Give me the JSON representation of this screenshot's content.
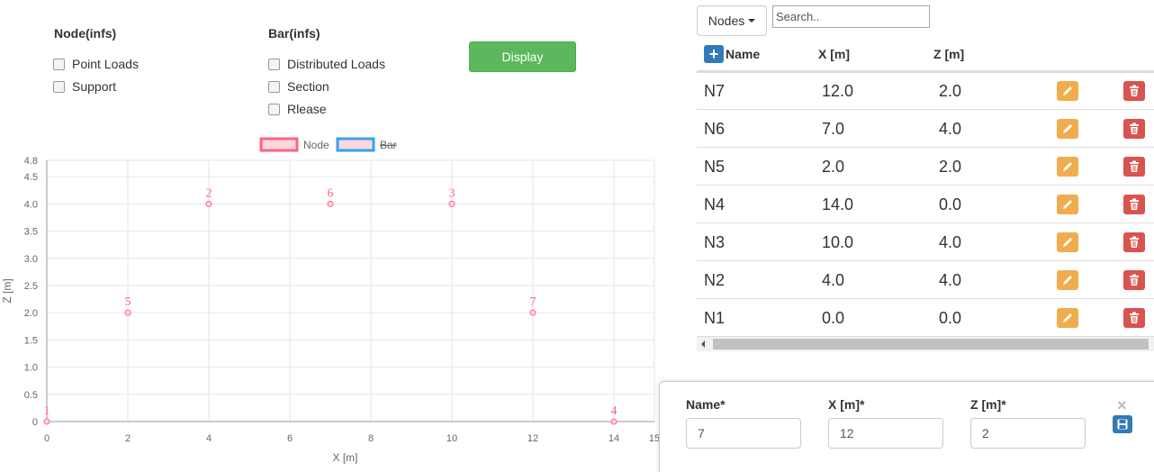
{
  "controls": {
    "node_group_title": "Node(infs)",
    "node_options": [
      "Point Loads",
      "Support"
    ],
    "bar_group_title": "Bar(infs)",
    "bar_options": [
      "Distributed Loads",
      "Section",
      "Rlease"
    ],
    "display_label": "Display"
  },
  "chart_data": {
    "type": "scatter",
    "legend": [
      {
        "label": "Node",
        "border": "#ff6384",
        "fill": "#ffd6de",
        "hidden": false
      },
      {
        "label": "Bar",
        "border": "#36a2eb",
        "fill": "#ffd6de",
        "hidden": true
      }
    ],
    "legend_position": "top-center",
    "xlabel": "X [m]",
    "ylabel": "Z [m]",
    "xlim": [
      0,
      15
    ],
    "ylim": [
      0,
      4.8
    ],
    "x_ticks": [
      "0",
      "2",
      "4",
      "6",
      "8",
      "10",
      "12",
      "14",
      "15"
    ],
    "y_ticks": [
      "0",
      "0.5",
      "1.0",
      "1.5",
      "2.0",
      "2.5",
      "3.0",
      "3.5",
      "4.0",
      "4.5",
      "4.8"
    ],
    "grid": true,
    "point_color": "#ff6384",
    "points": [
      {
        "label": "1",
        "x": 0,
        "y": 0
      },
      {
        "label": "2",
        "x": 4,
        "y": 4
      },
      {
        "label": "3",
        "x": 10,
        "y": 4
      },
      {
        "label": "4",
        "x": 14,
        "y": 0
      },
      {
        "label": "5",
        "x": 2,
        "y": 2
      },
      {
        "label": "6",
        "x": 7,
        "y": 4
      },
      {
        "label": "7",
        "x": 12,
        "y": 2
      }
    ]
  },
  "table": {
    "dropdown_label": "Nodes",
    "search_placeholder": "Search..",
    "add_icon": "plus-icon",
    "headers": [
      "Name",
      "X [m]",
      "Z [m]"
    ],
    "rows": [
      {
        "name": "N7",
        "x": "12.0",
        "z": "2.0"
      },
      {
        "name": "N6",
        "x": "7.0",
        "z": "4.0"
      },
      {
        "name": "N5",
        "x": "2.0",
        "z": "2.0"
      },
      {
        "name": "N4",
        "x": "14.0",
        "z": "0.0"
      },
      {
        "name": "N3",
        "x": "10.0",
        "z": "4.0"
      },
      {
        "name": "N2",
        "x": "4.0",
        "z": "4.0"
      },
      {
        "name": "N1",
        "x": "0.0",
        "z": "0.0"
      }
    ],
    "edit_color": "#f0ad4e",
    "delete_color": "#d9534f"
  },
  "edit_form": {
    "name_label": "Name*",
    "name_value": "7",
    "x_label": "X [m]*",
    "x_value": "12",
    "z_label": "Z [m]*",
    "z_value": "2"
  }
}
